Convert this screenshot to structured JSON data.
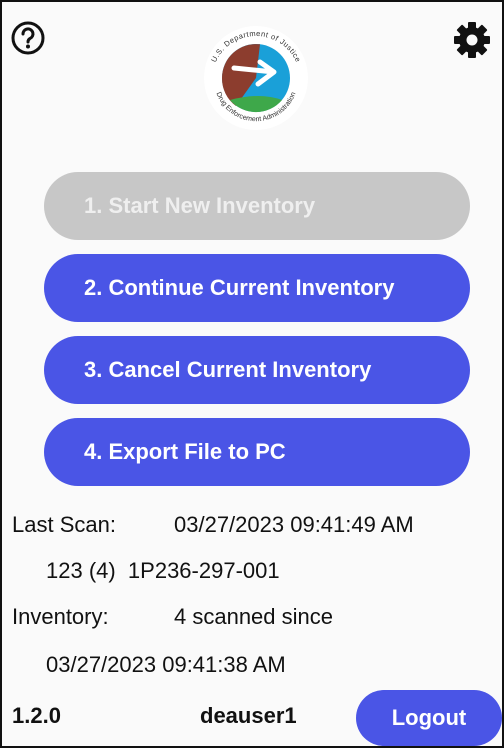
{
  "header": {
    "help_icon": "question-circle-icon",
    "settings_icon": "gear-icon",
    "logo": {
      "top_text": "U.S. Department of Justice",
      "bottom_text": "Drug Enforcement Administration",
      "colors": {
        "brown": "#8c3d2e",
        "blue": "#1aa0d8",
        "green": "#3ea84a"
      }
    }
  },
  "menu": {
    "items": [
      {
        "label": "1. Start New Inventory",
        "enabled": false
      },
      {
        "label": "2. Continue Current Inventory",
        "enabled": true
      },
      {
        "label": "3. Cancel Current Inventory",
        "enabled": true
      },
      {
        "label": "4. Export File to PC",
        "enabled": true
      }
    ]
  },
  "status": {
    "last_scan_label": "Last Scan:",
    "last_scan_value": "03/27/2023 09:41:49 AM",
    "last_scan_detail": "123 (4)  1P236-297-001",
    "inventory_label": "Inventory:",
    "inventory_value": "4 scanned since",
    "inventory_since": "03/27/2023 09:41:38 AM"
  },
  "footer": {
    "version": "1.2.0",
    "username": "deauser1",
    "logout_label": "Logout"
  },
  "colors": {
    "accent": "#4a55e6",
    "disabled": "#c7c7c7"
  }
}
